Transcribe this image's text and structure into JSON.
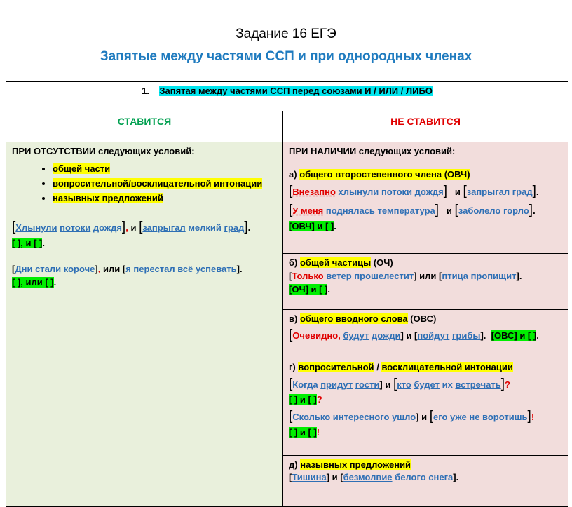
{
  "title": "Задание 16 ЕГЭ",
  "subtitle": "Запятые  между частями ССП и при однородных  членах",
  "rule": {
    "num": "1.",
    "text": "Запятая между частями ССП перед союзами И / ИЛИ / ЛИБО"
  },
  "left": {
    "header": "СТАВИТСЯ",
    "intro": "ПРИ  ОТСУТСТВИИ следующих условий:",
    "conditions": [
      "общей части",
      "вопросительной/восклицательной  интонации",
      "назывных предложений"
    ],
    "ex1": {
      "w1": "Хлынули",
      "w2": "потоки",
      "w3": "дождя",
      "comma": ",",
      "conj": "и",
      "w4": "запрыгал",
      "w5": "мелкий",
      "w6": "град",
      "end": ".",
      "scheme": "[ ], и [ ]",
      "dot": "."
    },
    "ex2": {
      "w1": "Дни",
      "w2": "стали",
      "w3": "короче",
      "comma": ",",
      "conj": "или",
      "w4": "я",
      "w5": "перестал",
      "w6": "всё",
      "w7": "успевать",
      "end": ".",
      "scheme": "[ ], или [ ]",
      "dot": "."
    }
  },
  "right": {
    "header": "НЕ СТАВИТСЯ",
    "intro": "ПРИ  НАЛИЧИИ следующих условий:",
    "a": {
      "label": "а)",
      "text": "общего второстепенного члена (ОВЧ)",
      "ex1": {
        "r": "Внезапно",
        "w1": "хлынули",
        "w2": "потоки",
        "w3": "дождя",
        "dash": "_",
        "conj": "и",
        "w4": "запрыгал",
        "w5": "град",
        "end": "."
      },
      "ex2": {
        "r1": "У меня",
        "w1": "поднялась",
        "w2": "температура",
        "dash": "_",
        "conj": "и",
        "w3": "заболело",
        "w4": "горло",
        "end": "."
      },
      "scheme": "[ОВЧ] и [ ]",
      "dot": "."
    },
    "b": {
      "label": "б)",
      "text": "общей частицы",
      "abbr": "(ОЧ)",
      "ex": {
        "r1": "Только",
        "w1": "ветер",
        "w2": "прошелестит",
        "conj": "или",
        "w3": "птица",
        "w4": "пропищит",
        "end": "."
      },
      "scheme": "[ОЧ] и [ ]",
      "dot": "."
    },
    "c": {
      "label": "в)",
      "text": "общего вводного слова",
      "abbr": "(ОВС)",
      "ex": {
        "r1": "Очевидно,",
        "w1": "будут",
        "w2": "дожди",
        "conj": "и",
        "w3": "пойдут",
        "w4": "грибы",
        "end": ".",
        "scheme": "[ОВС] и [ ]",
        "dot": "."
      }
    },
    "d": {
      "label": "г)",
      "t1": "вопросительной",
      "slash": "/",
      "t2": "восклицательной  интонации",
      "ex1": {
        "w1": "Когда",
        "w2": "придут",
        "w3": "гости",
        "conj": "и",
        "w4": "кто",
        "w5": "будет",
        "w6": "их",
        "w7": "встречать",
        "end": "?",
        "scheme": "[ ] и [ ]",
        "send": "?"
      },
      "ex2": {
        "w1": "Сколько",
        "w2": "интересного",
        "w3": "ушло",
        "conj": "и",
        "w4": "его уже",
        "w5": "не воротишь",
        "end": "!",
        "scheme": "[ ] и [ ]",
        "send": "!"
      }
    },
    "e": {
      "label": "д)",
      "text": "назывных предложений",
      "ex": {
        "w1": "Тишина",
        "conj": "и",
        "w2": "безмолвие",
        "w3": "белого снега",
        "end": "."
      }
    }
  }
}
